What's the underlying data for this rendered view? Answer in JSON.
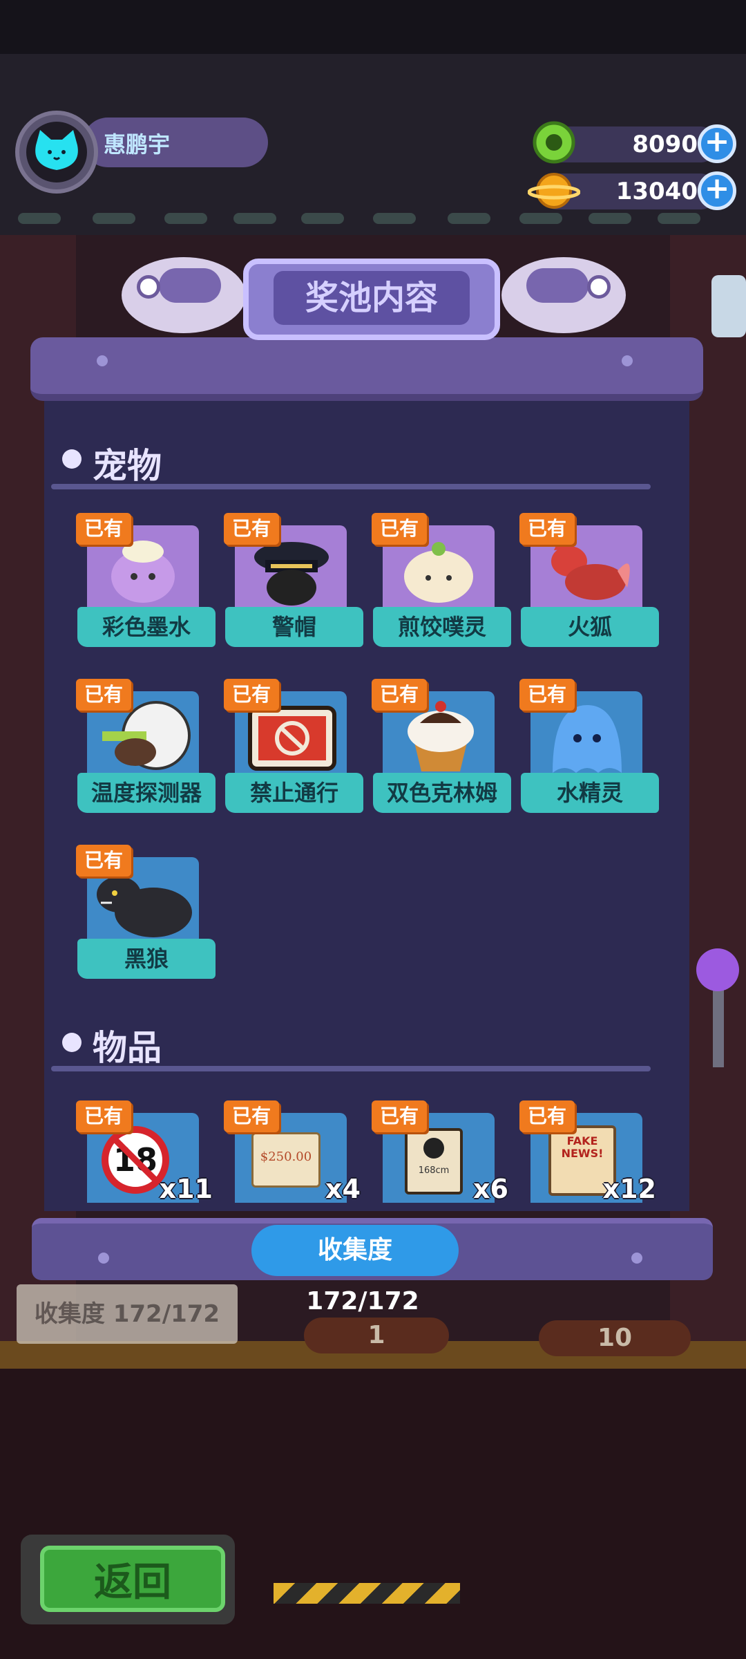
{
  "player": {
    "name": "惠鹏宇"
  },
  "currencies": [
    {
      "icon": "green-gem-icon",
      "value": "8090"
    },
    {
      "icon": "orange-planet-icon",
      "value": "13040"
    }
  ],
  "panel": {
    "title": "奖池内容"
  },
  "sections": {
    "pets": {
      "title": "宠物"
    },
    "items": {
      "title": "物品"
    }
  },
  "pets": [
    {
      "badge": "已有",
      "name": "彩色墨水",
      "icon": "ink-blob-pet-icon"
    },
    {
      "badge": "已有",
      "name": "警帽",
      "icon": "police-hat-pet-icon"
    },
    {
      "badge": "已有",
      "name": "煎饺噗灵",
      "icon": "dumpling-pet-icon"
    },
    {
      "badge": "已有",
      "name": "火狐",
      "icon": "fire-fox-pet-icon"
    },
    {
      "badge": "已有",
      "name": "温度探测器",
      "icon": "thermometer-pet-icon"
    },
    {
      "badge": "已有",
      "name": "禁止通行",
      "icon": "no-entry-sign-pet-icon"
    },
    {
      "badge": "已有",
      "name": "双色克林姆",
      "icon": "cream-puff-pet-icon"
    },
    {
      "badge": "已有",
      "name": "水精灵",
      "icon": "water-spirit-pet-icon"
    },
    {
      "badge": "已有",
      "name": "黑狼",
      "icon": "black-wolf-pet-icon"
    }
  ],
  "items": [
    {
      "badge": "已有",
      "count": "x11",
      "icon": "no-18-sign-icon"
    },
    {
      "badge": "已有",
      "count": "x4",
      "icon": "check-250-icon",
      "text": "$250.00"
    },
    {
      "badge": "已有",
      "count": "x6",
      "icon": "wanted-poster-icon",
      "text": "168cm"
    },
    {
      "badge": "已有",
      "count": "x12",
      "icon": "fake-news-paper-icon",
      "text": "FAKE NEWS!"
    }
  ],
  "collection": {
    "label": "收集度",
    "value": "172/172"
  },
  "background": {
    "collection_text": "收集度 172/172",
    "price_1": "1",
    "price_10": "10"
  },
  "back_button": {
    "label": "返回"
  }
}
